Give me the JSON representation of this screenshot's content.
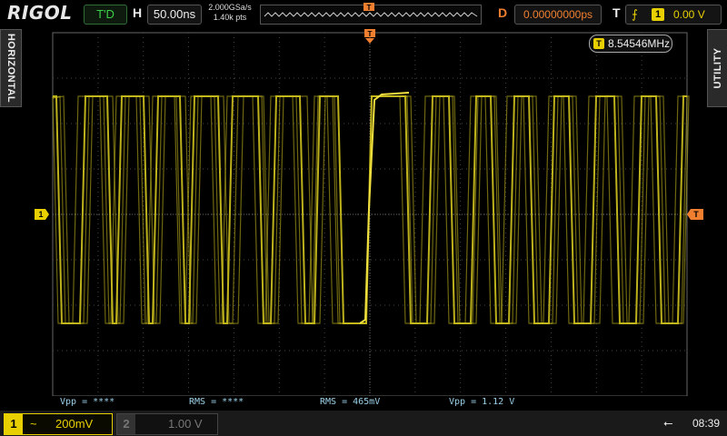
{
  "header": {
    "logo": "RIGOL",
    "trigger_status": "T'D",
    "horizontal_letter": "H",
    "timebase": "50.00ns",
    "sample_rate": "2.000GSa/s",
    "memory_depth": "1.40k pts",
    "delay_letter": "D",
    "delay": "0.00000000ps",
    "trigger_letter": "T",
    "trigger_source": "1",
    "trigger_level": "0.00 V"
  },
  "side_tabs": {
    "left": "HORIZONTAL",
    "right": "UTILITY"
  },
  "frequency_counter": {
    "source": "T",
    "value": "8.54546MHz"
  },
  "markers": {
    "ch1": "1",
    "trigger": "T"
  },
  "measurements": [
    {
      "label": "Vpp = ****"
    },
    {
      "label": "RMS = ****"
    },
    {
      "label": "RMS = 465mV"
    },
    {
      "label": "Vpp = 1.12 V"
    }
  ],
  "channels": {
    "ch1": {
      "number": "1",
      "coupling": "~",
      "scale": "200mV"
    },
    "ch2": {
      "number": "2",
      "scale": "1.00 V"
    }
  },
  "status": {
    "clock": "08:39",
    "usb_icon": "usb-icon"
  },
  "colors": {
    "ch1": "#e8d000",
    "trigger": "#f08030",
    "trace": "#c8bc1e"
  }
}
